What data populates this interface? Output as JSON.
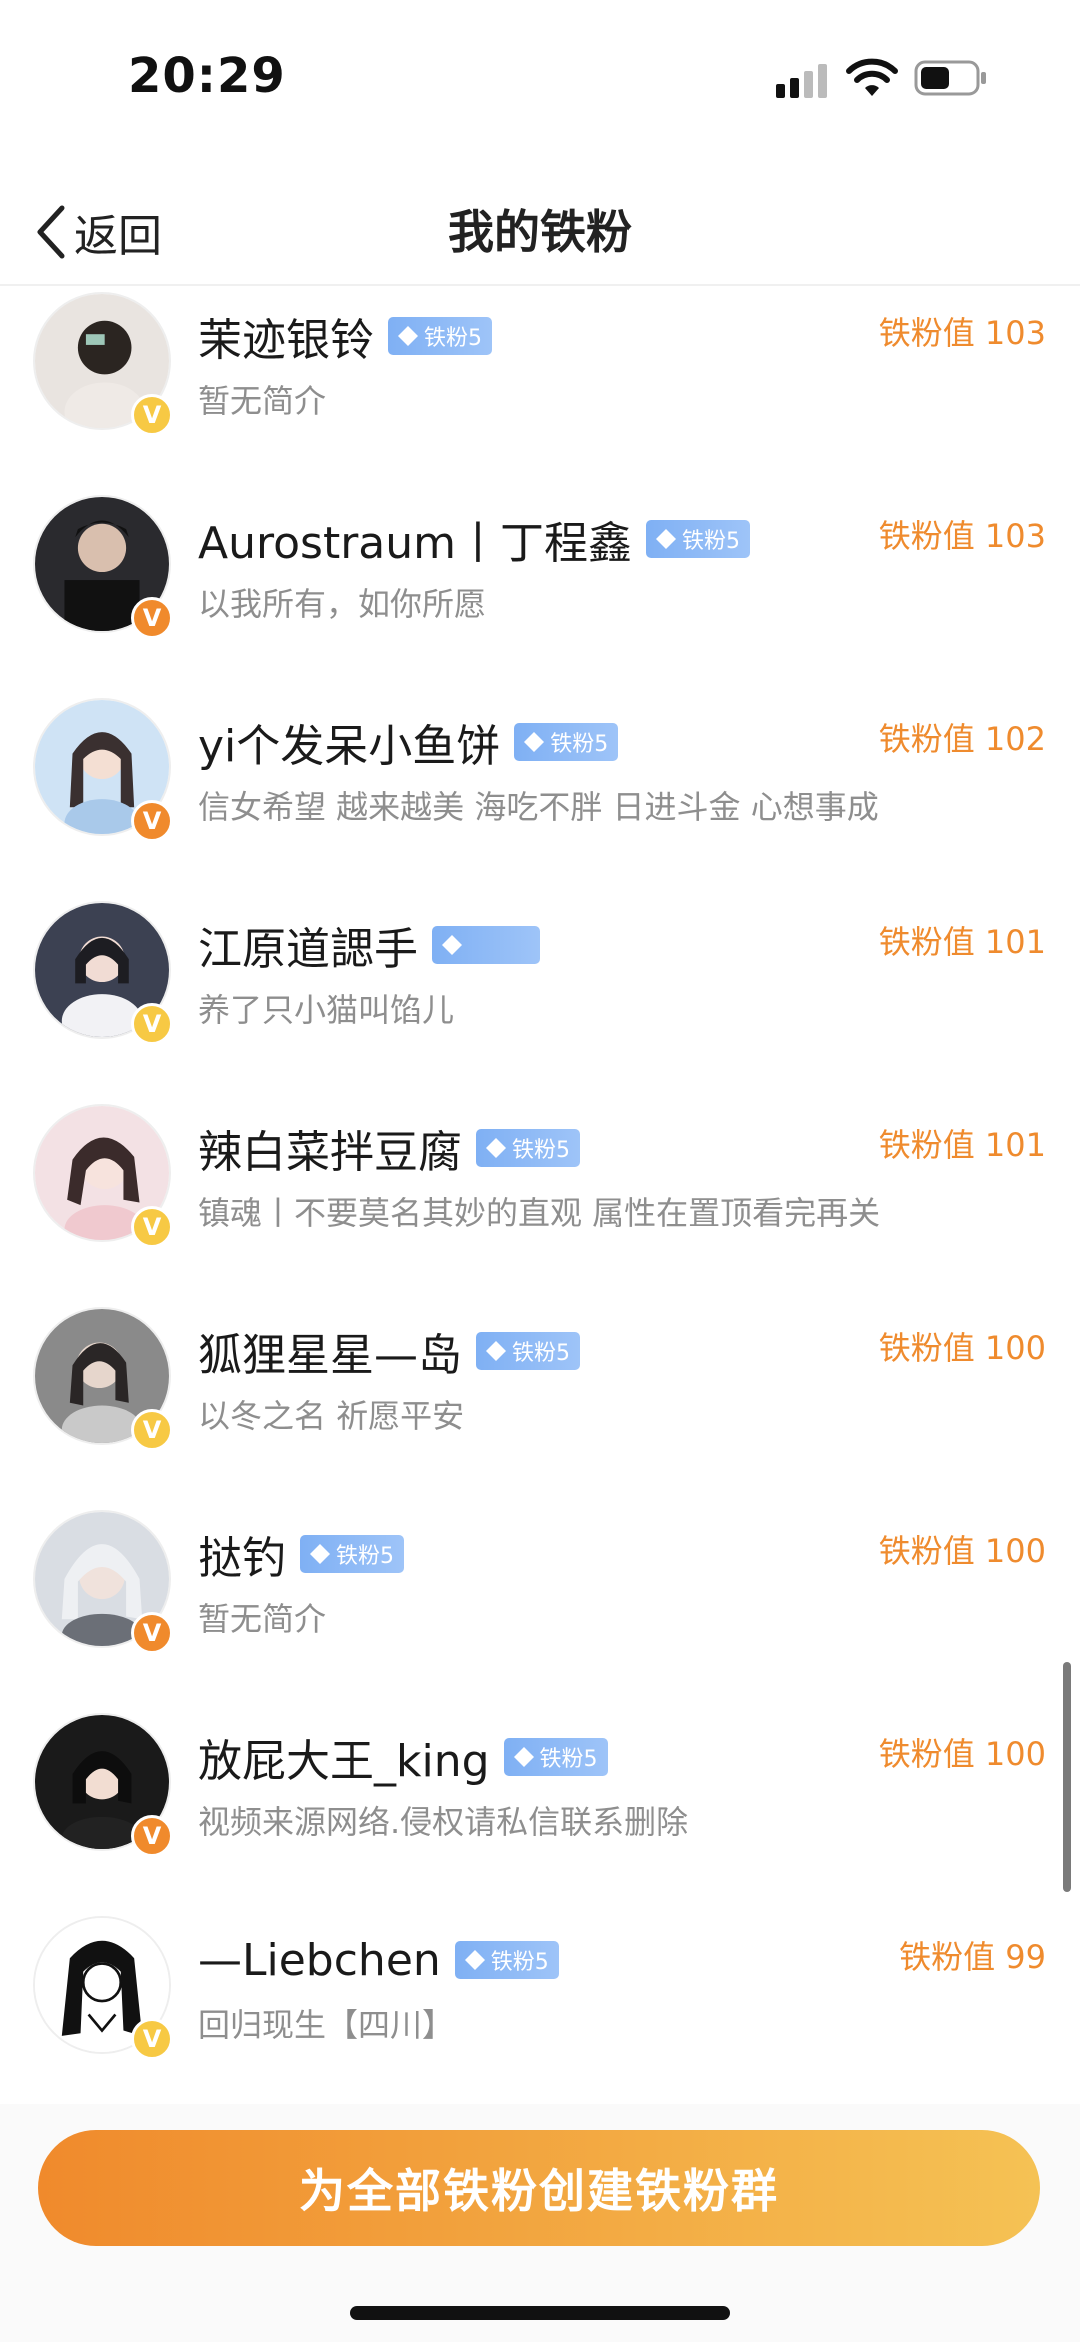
{
  "status_bar": {
    "time": "20:29",
    "icons": [
      "signal-icon",
      "wifi-icon",
      "battery-icon"
    ]
  },
  "nav": {
    "back_label": "返回",
    "title": "我的铁粉"
  },
  "fans": [
    {
      "name": "茉迹银铃",
      "badge": "铁粉5",
      "bio": "暂无简介",
      "value": "铁粉值 103",
      "verified_color": "yellow"
    },
    {
      "name": "Aurostraum丨丁程鑫",
      "badge": "铁粉5",
      "bio": "以我所有，如你所愿",
      "value": "铁粉值 103",
      "verified_color": "orange"
    },
    {
      "name": "yi个发呆小鱼饼",
      "badge": "铁粉5",
      "bio": "信女希望 越来越美 海吃不胖 日进斗金 心想事成",
      "value": "铁粉值 102",
      "verified_color": "orange"
    },
    {
      "name": "江原道諰手",
      "badge": "",
      "bio": "养了只小猫叫馅儿",
      "value": "铁粉值 101",
      "verified_color": "yellow"
    },
    {
      "name": "辣白菜拌豆腐",
      "badge": "铁粉5",
      "bio": "镇魂丨不要莫名其妙的直观 属性在置顶看完再关",
      "value": "铁粉值 101",
      "verified_color": "yellow"
    },
    {
      "name": "狐狸星星—岛",
      "badge": "铁粉5",
      "bio": "以冬之名 祈愿平安",
      "value": "铁粉值 100",
      "verified_color": "yellow"
    },
    {
      "name": "挞钓",
      "badge": "铁粉5",
      "bio": "暂无简介",
      "value": "铁粉值 100",
      "verified_color": "orange"
    },
    {
      "name": "放屁大王_king",
      "badge": "铁粉5",
      "bio": "视频来源网络.侵权请私信联系删除",
      "value": "铁粉值 100",
      "verified_color": "orange"
    },
    {
      "name": "—Liebchen",
      "badge": "铁粉5",
      "bio": "回归现生【四川】",
      "value": "铁粉值 99",
      "verified_color": "yellow"
    }
  ],
  "verified_mark": "V",
  "bottom": {
    "button_label": "为全部铁粉创建铁粉群"
  },
  "colors": {
    "accent_orange": "#ef8b2e",
    "badge_blue": "#7fb0f4",
    "verified_yellow": "#f7c944",
    "verified_orange": "#f08a2c"
  }
}
